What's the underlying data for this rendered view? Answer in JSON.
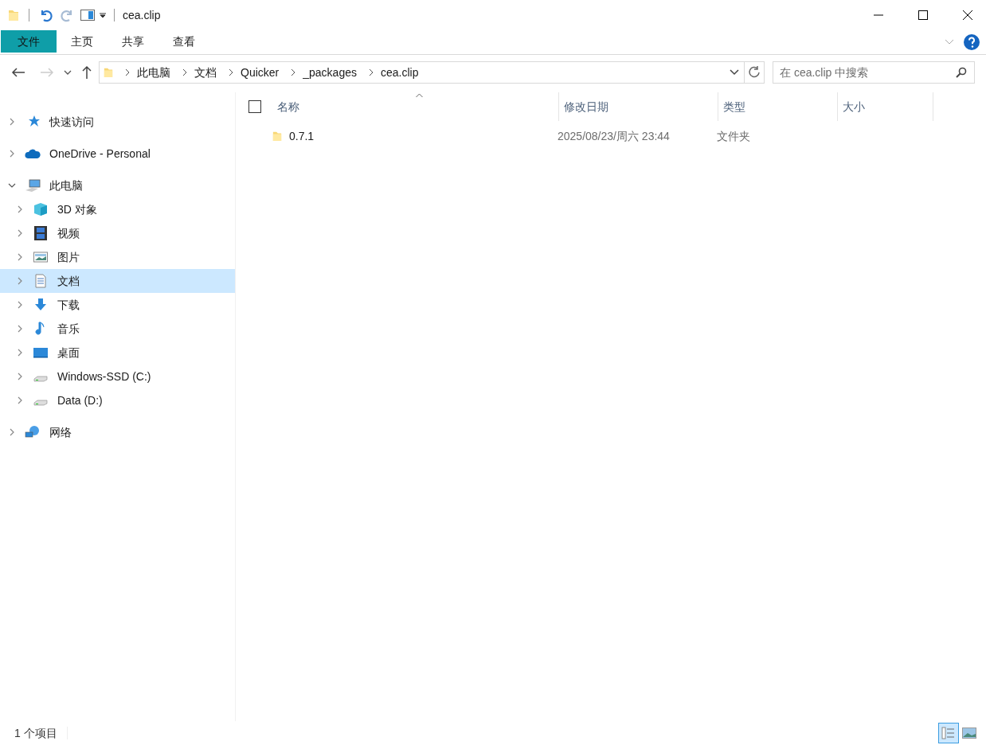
{
  "window": {
    "title": "cea.clip"
  },
  "ribbon_tabs": [
    {
      "label": "文件",
      "kind": "file"
    },
    {
      "label": "主页",
      "kind": "tab"
    },
    {
      "label": "共享",
      "kind": "tab"
    },
    {
      "label": "查看",
      "kind": "tab"
    }
  ],
  "address_bar": {
    "crumbs": [
      "此电脑",
      "文档",
      "Quicker",
      "_packages",
      "cea.clip"
    ]
  },
  "search": {
    "placeholder": "在 cea.clip 中搜索"
  },
  "navigation": [
    {
      "label": "快速访问",
      "kind": "star",
      "expanded": false,
      "selected": false
    },
    {
      "label": "OneDrive - Personal",
      "kind": "cloud",
      "expanded": false,
      "selected": false
    },
    {
      "label": "此电脑",
      "kind": "pc",
      "expanded": true,
      "selected": false,
      "children": [
        {
          "label": "3D 对象",
          "kind": "cube",
          "expanded": false,
          "selected": false
        },
        {
          "label": "视频",
          "kind": "film",
          "expanded": false,
          "selected": false
        },
        {
          "label": "图片",
          "kind": "picture",
          "expanded": false,
          "selected": false
        },
        {
          "label": "文档",
          "kind": "document",
          "expanded": false,
          "selected": true
        },
        {
          "label": "下载",
          "kind": "download",
          "expanded": false,
          "selected": false
        },
        {
          "label": "音乐",
          "kind": "music",
          "expanded": false,
          "selected": false
        },
        {
          "label": "桌面",
          "kind": "desktop",
          "expanded": false,
          "selected": false
        },
        {
          "label": "Windows-SSD (C:)",
          "kind": "drive",
          "expanded": false,
          "selected": false
        },
        {
          "label": "Data (D:)",
          "kind": "drive",
          "expanded": false,
          "selected": false
        }
      ]
    },
    {
      "label": "网络",
      "kind": "network",
      "expanded": false,
      "selected": false
    }
  ],
  "file_list": {
    "select_all": {
      "checked": false
    },
    "columns": [
      {
        "label": "名称",
        "sorted": true
      },
      {
        "label": "修改日期",
        "sorted": false
      },
      {
        "label": "类型",
        "sorted": false
      },
      {
        "label": "大小",
        "sorted": false
      }
    ],
    "rows": [
      {
        "name": "0.7.1",
        "modified": "2025/08/23/周六 23:44",
        "type": "文件夹",
        "selected": false
      }
    ]
  },
  "status_bar": {
    "item_count": "1 个项目",
    "views": [
      {
        "kind": "details",
        "selected": true
      },
      {
        "kind": "thumbnails",
        "selected": false
      }
    ]
  }
}
